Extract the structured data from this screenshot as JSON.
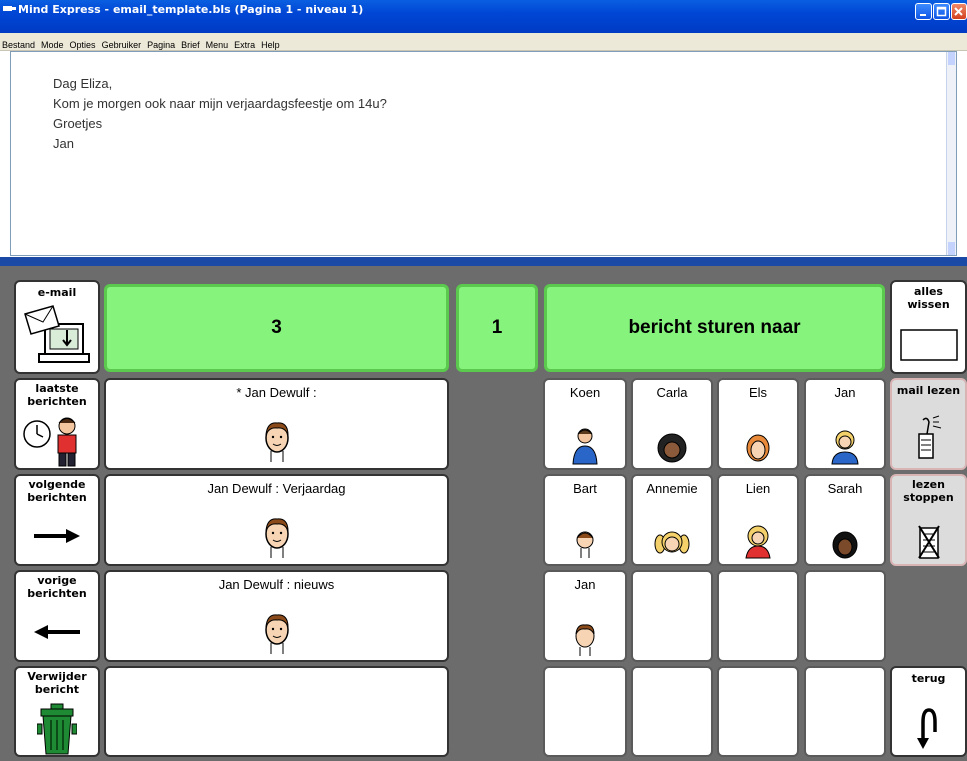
{
  "window": {
    "title": "Mind Express - email_template.bls (Pagina 1 - niveau 1)"
  },
  "menu": [
    "Bestand",
    "Mode",
    "Opties",
    "Gebruiker",
    "Pagina",
    "Brief",
    "Menu",
    "Extra",
    "Help"
  ],
  "letter": {
    "lines": [
      "Dag Eliza,",
      "Kom je morgen ook naar mijn verjaardagsfeestje om 14u?",
      "Groetjes",
      "Jan"
    ]
  },
  "left_column": {
    "email": "e-mail",
    "latest_line1": "laatste",
    "latest_line2": "berichten",
    "next_line1": "volgende",
    "next_line2": "berichten",
    "prev_line1": "vorige",
    "prev_line2": "berichten",
    "delete_line1": "Verwijder",
    "delete_line2": "bericht"
  },
  "status": {
    "count": "3",
    "page": "1",
    "action": "bericht sturen naar"
  },
  "messages": [
    "* Jan Dewulf :",
    "Jan Dewulf : Verjaardag",
    "Jan Dewulf : nieuws"
  ],
  "contacts": [
    "Koen",
    "Carla",
    "Els",
    "Jan",
    "Bart",
    "Annemie",
    "Lien",
    "Sarah",
    "Jan"
  ],
  "right_column": {
    "clear_line1": "alles",
    "clear_line2": "wissen",
    "read_mail": "mail lezen",
    "stop_line1": "lezen",
    "stop_line2": "stoppen",
    "back": "terug"
  },
  "colors": {
    "green": "#86f37d",
    "title_blue": "#0046d5",
    "divider": "#1b4aa6",
    "grid_bg": "#6c6c6c"
  }
}
